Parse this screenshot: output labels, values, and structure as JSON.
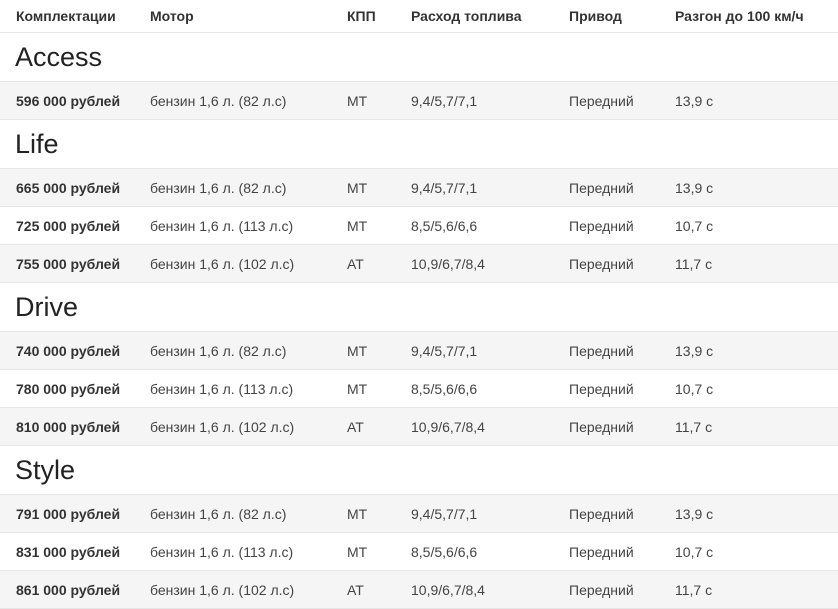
{
  "headers": {
    "trim": "Комплектации",
    "engine": "Мотор",
    "gearbox": "КПП",
    "fuel": "Расход топлива",
    "drive": "Привод",
    "accel": "Разгон до 100 км/ч"
  },
  "groups": [
    {
      "title": "Access",
      "rows": [
        {
          "price": "596 000 рублей",
          "engine": "бензин 1,6 л. (82 л.с)",
          "gearbox": "МТ",
          "fuel": "9,4/5,7/7,1",
          "drive": "Передний",
          "accel": "13,9 с"
        }
      ]
    },
    {
      "title": "Life",
      "rows": [
        {
          "price": "665 000 рублей",
          "engine": "бензин 1,6 л. (82 л.с)",
          "gearbox": "МТ",
          "fuel": "9,4/5,7/7,1",
          "drive": "Передний",
          "accel": "13,9 с"
        },
        {
          "price": "725 000 рублей",
          "engine": "бензин 1,6 л. (113 л.с)",
          "gearbox": "МТ",
          "fuel": "8,5/5,6/6,6",
          "drive": "Передний",
          "accel": "10,7 с"
        },
        {
          "price": "755 000 рублей",
          "engine": "бензин 1,6 л. (102 л.с)",
          "gearbox": "АТ",
          "fuel": "10,9/6,7/8,4",
          "drive": "Передний",
          "accel": "11,7 с"
        }
      ]
    },
    {
      "title": "Drive",
      "rows": [
        {
          "price": "740 000 рублей",
          "engine": "бензин 1,6 л. (82 л.с)",
          "gearbox": "МТ",
          "fuel": "9,4/5,7/7,1",
          "drive": "Передний",
          "accel": "13,9 с"
        },
        {
          "price": "780 000 рублей",
          "engine": "бензин 1,6 л. (113 л.с)",
          "gearbox": "МТ",
          "fuel": "8,5/5,6/6,6",
          "drive": "Передний",
          "accel": "10,7 с"
        },
        {
          "price": "810 000 рублей",
          "engine": "бензин 1,6 л. (102 л.с)",
          "gearbox": "АТ",
          "fuel": "10,9/6,7/8,4",
          "drive": "Передний",
          "accel": "11,7 с"
        }
      ]
    },
    {
      "title": "Style",
      "rows": [
        {
          "price": "791 000 рублей",
          "engine": "бензин 1,6 л. (82 л.с)",
          "gearbox": "МТ",
          "fuel": "9,4/5,7/7,1",
          "drive": "Передний",
          "accel": "13,9 с"
        },
        {
          "price": "831 000 рублей",
          "engine": "бензин 1,6 л. (113 л.с)",
          "gearbox": "МТ",
          "fuel": "8,5/5,6/6,6",
          "drive": "Передний",
          "accel": "10,7 с"
        },
        {
          "price": "861 000 рублей",
          "engine": "бензин 1,6 л. (102 л.с)",
          "gearbox": "АТ",
          "fuel": "10,9/6,7/8,4",
          "drive": "Передний",
          "accel": "11,7 с"
        }
      ]
    }
  ]
}
